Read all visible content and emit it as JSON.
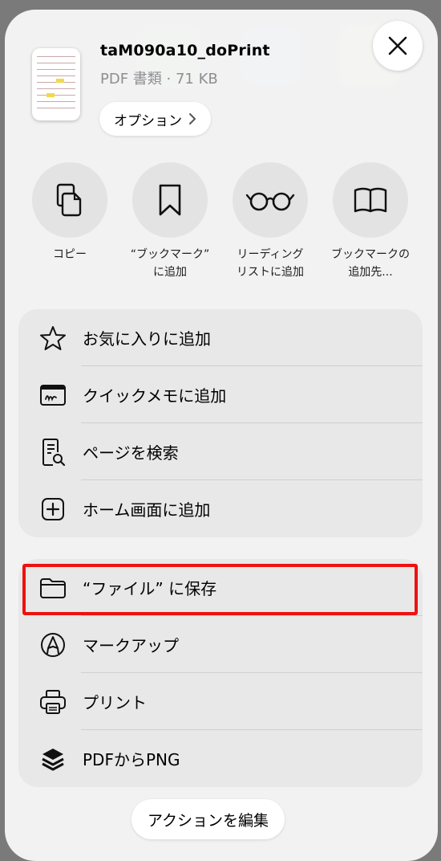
{
  "file": {
    "name": "taM090a10_doPrint",
    "meta": "PDF 書類 · 71 KB"
  },
  "options_label": "オプション",
  "quick_actions": [
    {
      "line1": "コピー",
      "line2": "",
      "icon": "copy-icon"
    },
    {
      "line1": "“ブックマーク”",
      "line2": "に追加",
      "icon": "bookmark-icon"
    },
    {
      "line1": "リーディング",
      "line2": "リストに追加",
      "icon": "reading-glasses-icon"
    },
    {
      "line1": "ブックマークの",
      "line2": "追加先...",
      "icon": "book-icon"
    }
  ],
  "group1": [
    {
      "label": "お気に入りに追加",
      "icon": "star-icon"
    },
    {
      "label": "クイックメモに追加",
      "icon": "quick-note-icon"
    },
    {
      "label": "ページを検索",
      "icon": "find-on-page-icon"
    },
    {
      "label": "ホーム画面に追加",
      "icon": "add-square-icon"
    }
  ],
  "group2": [
    {
      "label": "“ファイル” に保存",
      "icon": "folder-icon"
    },
    {
      "label": "マークアップ",
      "icon": "markup-pen-icon"
    },
    {
      "label": "プリント",
      "icon": "printer-icon"
    },
    {
      "label": "PDFからPNG",
      "icon": "layers-icon"
    }
  ],
  "edit_actions_label": "アクションを編集",
  "colors": {
    "highlight": "#ee1111",
    "sheet": "#f6f6f6",
    "group": "#e8e8e8"
  }
}
